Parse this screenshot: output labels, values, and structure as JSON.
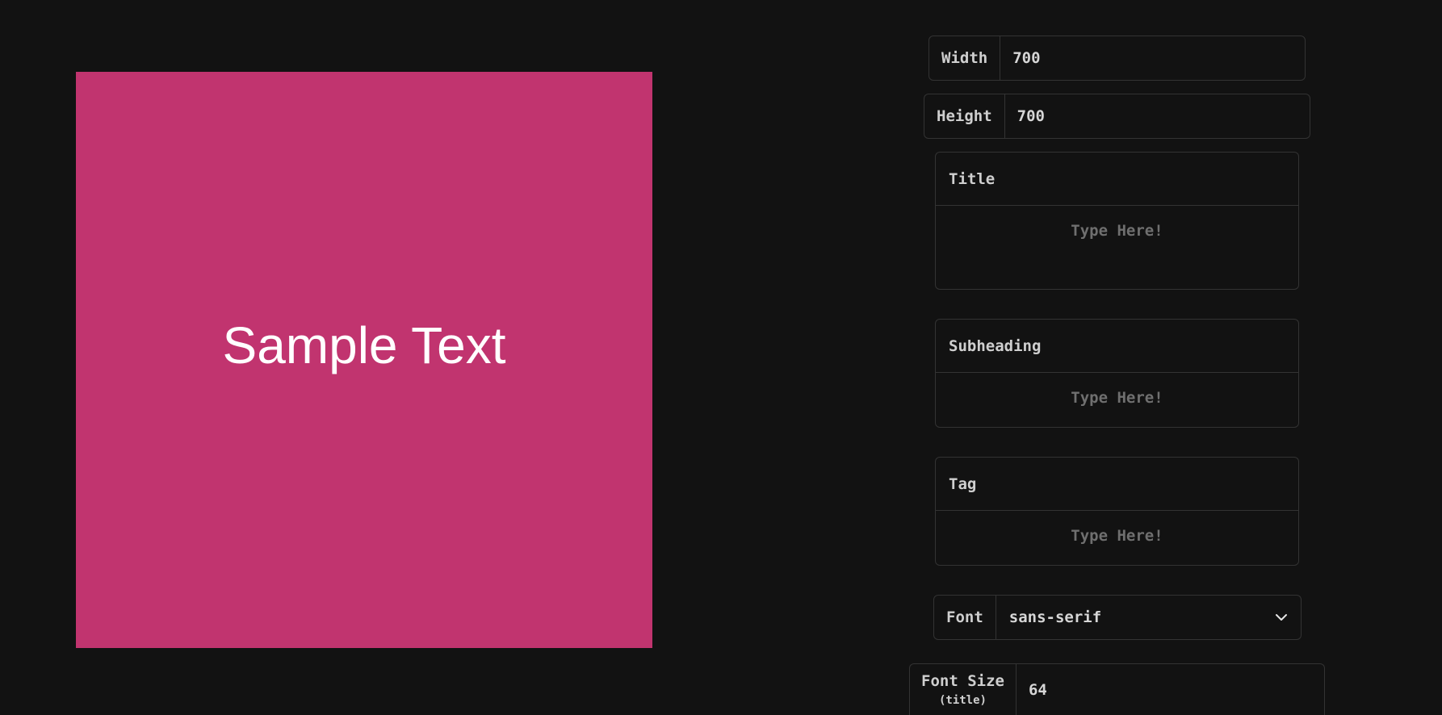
{
  "preview": {
    "background": "#C1346F",
    "text_color": "#FFFFFF",
    "title_text": "Sample Text"
  },
  "controls": {
    "width": {
      "label": "Width",
      "value": "700"
    },
    "height": {
      "label": "Height",
      "value": "700"
    },
    "title": {
      "label": "Title",
      "placeholder": "Type Here!"
    },
    "subheading": {
      "label": "Subheading",
      "placeholder": "Type Here!"
    },
    "tag": {
      "label": "Tag",
      "placeholder": "Type Here!"
    },
    "font": {
      "label": "Font",
      "value": "sans-serif"
    },
    "font_size_title": {
      "label": "Font Size",
      "sub_label": "(title)",
      "value": "64"
    }
  },
  "colors": {
    "page_background": "#121212",
    "border": "#333333",
    "text": "#CFCFCF",
    "placeholder": "#6F6F6F"
  },
  "icons": {
    "font_dropdown": "chevron-down-icon"
  }
}
